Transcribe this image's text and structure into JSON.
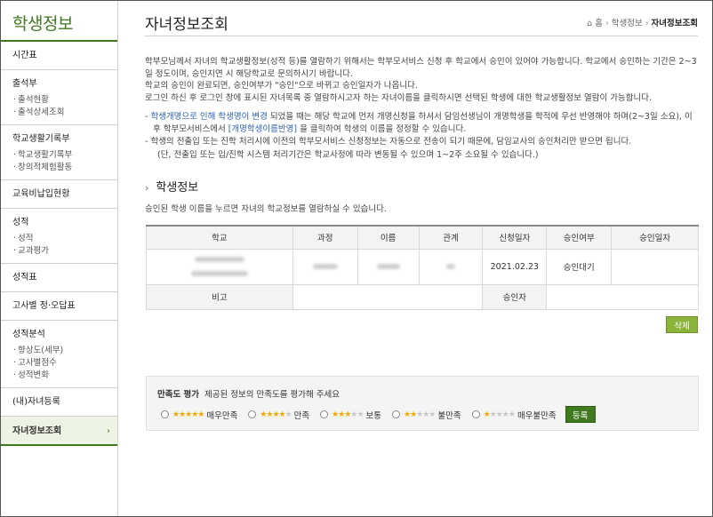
{
  "sidebar": {
    "title": "학생정보",
    "menu": [
      {
        "label": "시간표",
        "sub": []
      },
      {
        "label": "출석부",
        "sub": [
          "출석현황",
          "출석상세조회"
        ]
      },
      {
        "label": "학교생활기록부",
        "sub": [
          "학교생활기록부",
          "창의적체험활동"
        ]
      },
      {
        "label": "교육비납입현황",
        "sub": []
      },
      {
        "label": "성적",
        "sub": [
          "성적",
          "교과평가"
        ]
      },
      {
        "label": "성적표",
        "sub": []
      },
      {
        "label": "고사별 정·오답표",
        "sub": []
      },
      {
        "label": "성적분석",
        "sub": [
          "향상도(세부)",
          "고사별점수",
          "성적변화"
        ]
      },
      {
        "label": "(내)자녀등록",
        "sub": []
      }
    ],
    "active": "자녀정보조회"
  },
  "header": {
    "title": "자녀정보조회",
    "breadcrumb": [
      "홈",
      "학생정보",
      "자녀정보조회"
    ]
  },
  "intro": {
    "line1": "학부모님께서 자녀의 학교생활정보(성적 등)를 열람하기 위해서는 학부모서비스 신청 후 학교에서 승인이 있어야 가능합니다. 학교에서 승인하는 기간은 2~3일 정도이며, 승인지연 시 해당학교로 문의하시기 바랍니다.",
    "line2": "학교의 승인이 완료되면, 승인여부가 \"승인\"으로 바뀌고 승인일자가 나옵니다.",
    "line3": "로그인 하신 후 로그인 창에 표시된 자녀목록 중 열람하시고자 하는 자녀이름을 클릭하시면 선택된 학생에 대한 학교생활정보 열람이 가능합니다."
  },
  "notes": {
    "n1_prefix": "- ",
    "n1_link": "학생개명으로 인해 학생명이 변경",
    "n1_mid": " 되었을 때는 해당 학교에 먼저 개명신청을 하셔서 담임선생님이 개명학생을 학적에 우선 반영해야 하며(2~3일 소요), 이후 학부모서비스에서 ",
    "n1_link2": "[개명학생이름반영]",
    "n1_end": " 을 클릭하여 학생의 이름을 정정할 수 있습니다.",
    "n2": "- 학생의 전출입 또는 진학 처리시에 이전의 학부모서비스 신청정보는 자동으로 전송이 되기 때문에, 담임교사의 승인처리만 받으면 됩니다.",
    "n3": "(단, 전출입 또는 입/진학 시스템 처리기간은 학교사정에 따라 변동될 수 있으며 1~2주 소요될 수 있습니다.)"
  },
  "section": {
    "title": "학생정보",
    "desc": "승인된 학생 이름을 누르면 자녀의 학교정보를 열람하실 수 있습니다."
  },
  "table": {
    "headers": [
      "학교",
      "과정",
      "이름",
      "관계",
      "신청일자",
      "승인여부",
      "승인일자"
    ],
    "row": {
      "apply_date": "2021.02.23",
      "status": "승인대기",
      "approve_date": ""
    },
    "remark_label": "비고",
    "approver_label": "승인자"
  },
  "delete_label": "삭제",
  "rating": {
    "title": "만족도 평가",
    "desc": "제공된 정보의 만족도를 평가해 주세요",
    "options": [
      {
        "label": "매우만족",
        "stars": 5
      },
      {
        "label": "만족",
        "stars": 4
      },
      {
        "label": "보통",
        "stars": 3
      },
      {
        "label": "불만족",
        "stars": 2
      },
      {
        "label": "매우불만족",
        "stars": 1
      }
    ],
    "submit": "등록"
  },
  "colors": {
    "accent": "#3f7a1f",
    "button": "#8cb33a",
    "link": "#2a5fb0"
  }
}
